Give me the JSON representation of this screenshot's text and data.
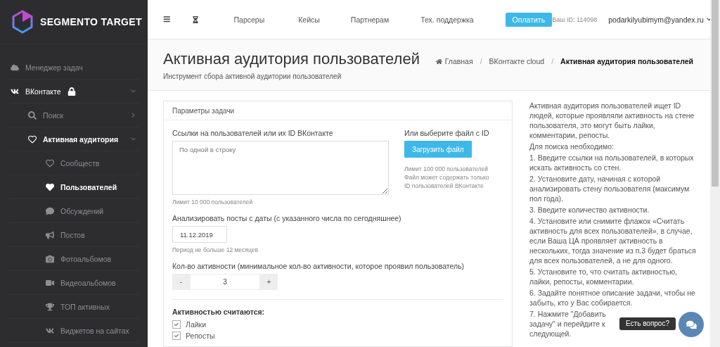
{
  "brand": {
    "name": "SEGMENTO TARGET"
  },
  "sidebar": {
    "items": [
      {
        "label": "Менеджер задач",
        "expanded": false
      },
      {
        "label": "ВКонтакте",
        "locked": true,
        "expanded": true,
        "children": [
          {
            "label": "Поиск",
            "expanded": false
          },
          {
            "label": "Активная аудитория",
            "expanded": true,
            "children": [
              {
                "label": "Сообществ",
                "selected": false
              },
              {
                "label": "Пользователей",
                "selected": true
              },
              {
                "label": "Обсуждений",
                "selected": false
              },
              {
                "label": "Постов",
                "selected": false
              },
              {
                "label": "Фотоальбомов",
                "selected": false
              },
              {
                "label": "Видеоальбомов",
                "selected": false
              },
              {
                "label": "ТОП активных",
                "selected": false
              },
              {
                "label": "Виджетов на сайтах",
                "selected": false
              }
            ]
          }
        ]
      }
    ]
  },
  "topbar": {
    "nav": [
      "Парсеры",
      "Кейсы",
      "Партнерам",
      "Тех. поддержка"
    ],
    "pay_button": "Оплатить",
    "user_id": "Ваш ID: 114098",
    "email": "podarkilyubimym@yandex.ru"
  },
  "page": {
    "title": "Активная аудитория пользователей",
    "subtitle": "Инструмент сбора активной аудитории пользователей",
    "breadcrumb_separator": "/",
    "breadcrumbs": [
      {
        "label": "Главная",
        "current": false
      },
      {
        "label": "ВКонтакте cloud",
        "current": false
      },
      {
        "label": "Активная аудитория пользователей",
        "current": true
      }
    ]
  },
  "form": {
    "title": "Параметры задачи",
    "links": {
      "label": "Ссылки на пользователей или их ID ВКонтакте",
      "placeholder": "По одной в строку",
      "hint": "Лимит 10 000 пользователей"
    },
    "file": {
      "label": "Или выберите файл с ID",
      "button": "Загрузить файл",
      "hint": "Лимит 100 000 пользователей\nФайл может содержать только ID пользователей ВКонтакте"
    },
    "date": {
      "label": "Анализировать посты с даты (с указанного числа по сегодняшнее)",
      "value": "11.12.2019",
      "hint": "Период не больше 12 месяцев"
    },
    "count": {
      "label": "Кол-во активности (минимальное кол-во активности, которое проявил пользователь)",
      "minus": "-",
      "value": "3",
      "plus": "+"
    },
    "activity": {
      "title": "Активностью считаются:",
      "options": [
        {
          "label": "Лайки",
          "checked": true
        },
        {
          "label": "Репосты",
          "checked": true
        }
      ]
    }
  },
  "help": [
    "Активная аудитория пользователей ищет ID людей, которые проявляли активность на стене пользователя, это могут быть лайки, комментарии, репосты.",
    "Для поиска необходимо:",
    "1. Введите ссылки на пользователей, в которых искать активность со стен.",
    "2. Установите дату, начиная с которой анализировать стену пользователя (максимум пол года).",
    "3. Введите количество активности.",
    "4. Установите или снимите флажок «Считать активность для всех пользователей», в случае, если Ваша ЦА проявляет активность в нескольких, тогда значение из п.3 будет браться для всех пользователей, а не для одного.",
    "5. Установите то, что считать активностью, лайки, репосты, комментарии.",
    "6. Задайте понятное описание задачи, чтобы не забыть, кто у Вас собирается.",
    "7. Нажмите \"Добавить задачу\" и перейдите к следующей."
  ],
  "chat": {
    "tooltip": "Есть вопрос?"
  }
}
